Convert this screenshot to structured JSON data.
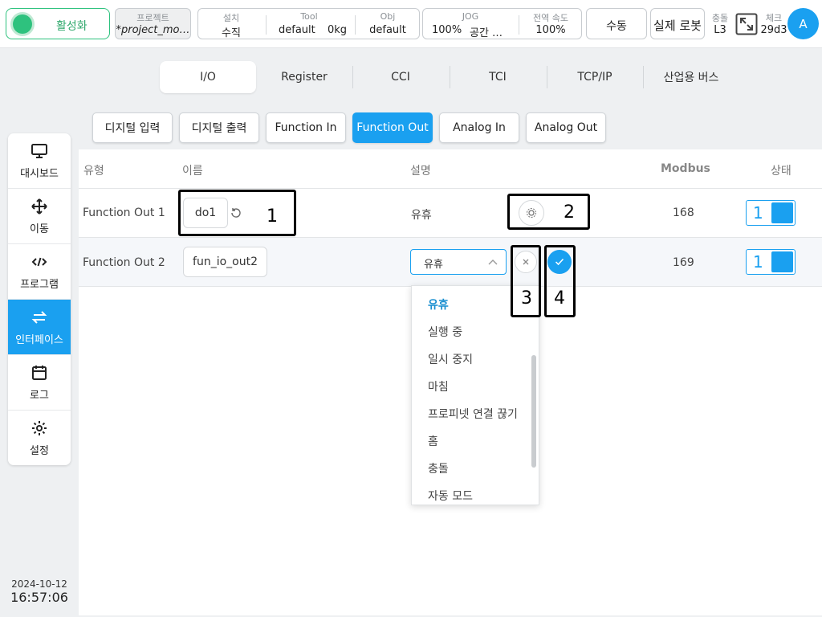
{
  "topbar": {
    "activate_label": "활성화",
    "project": {
      "label": "프로젝트",
      "value": "*project_mo…"
    },
    "install": {
      "label": "설치",
      "value": "수직"
    },
    "tool": {
      "label": "Tool",
      "value": "default",
      "weight": "0kg"
    },
    "obj": {
      "label": "Obj",
      "value": "default"
    },
    "jog": {
      "label": "JOG",
      "value": "100%",
      "mode": "공간 …"
    },
    "speed": {
      "label": "전역 속도",
      "value": "100%"
    },
    "manual_label": "수동",
    "real_robot_label": "실제 로봇",
    "collision": {
      "label": "충돌",
      "value": "L3"
    },
    "check": {
      "label": "체크",
      "value": "29d3"
    },
    "avatar_letter": "A"
  },
  "sidebar": {
    "items": [
      {
        "label": "대시보드",
        "icon": "monitor-icon"
      },
      {
        "label": "이동",
        "icon": "move-arrows-icon"
      },
      {
        "label": "프로그램",
        "icon": "code-icon"
      },
      {
        "label": "인터페이스",
        "icon": "swap-arrows-icon"
      },
      {
        "label": "로그",
        "icon": "calendar-icon"
      },
      {
        "label": "설정",
        "icon": "gear-icon"
      }
    ],
    "active_index": 3,
    "date": "2024-10-12",
    "time": "16:57:06"
  },
  "tabs": [
    "I/O",
    "Register",
    "CCI",
    "TCI",
    "TCP/IP",
    "산업용 버스"
  ],
  "subtabs": [
    "디지털 입력",
    "디지털 출력",
    "Function In",
    "Function Out",
    "Analog In",
    "Analog Out"
  ],
  "table": {
    "headers": {
      "type": "유형",
      "name": "이름",
      "desc": "설명",
      "modbus": "Modbus",
      "status": "상태"
    },
    "rows": [
      {
        "type": "Function Out 1",
        "name": "do1",
        "desc": "유휴",
        "modbus": "168",
        "status": "1"
      },
      {
        "type": "Function Out 2",
        "name": "fun_io_out2",
        "desc": "유휴",
        "modbus": "169",
        "status": "1"
      }
    ]
  },
  "dropdown": {
    "options": [
      "유휴",
      "실행 중",
      "일시 중지",
      "마침",
      "프로피넷 연결 끊기",
      "홈",
      "충돌",
      "자동 모드"
    ],
    "selected_index": 0
  },
  "annotations": [
    "1",
    "2",
    "3",
    "4"
  ],
  "colors": {
    "accent": "#1aa0f0",
    "active_green": "#2ec27e"
  }
}
